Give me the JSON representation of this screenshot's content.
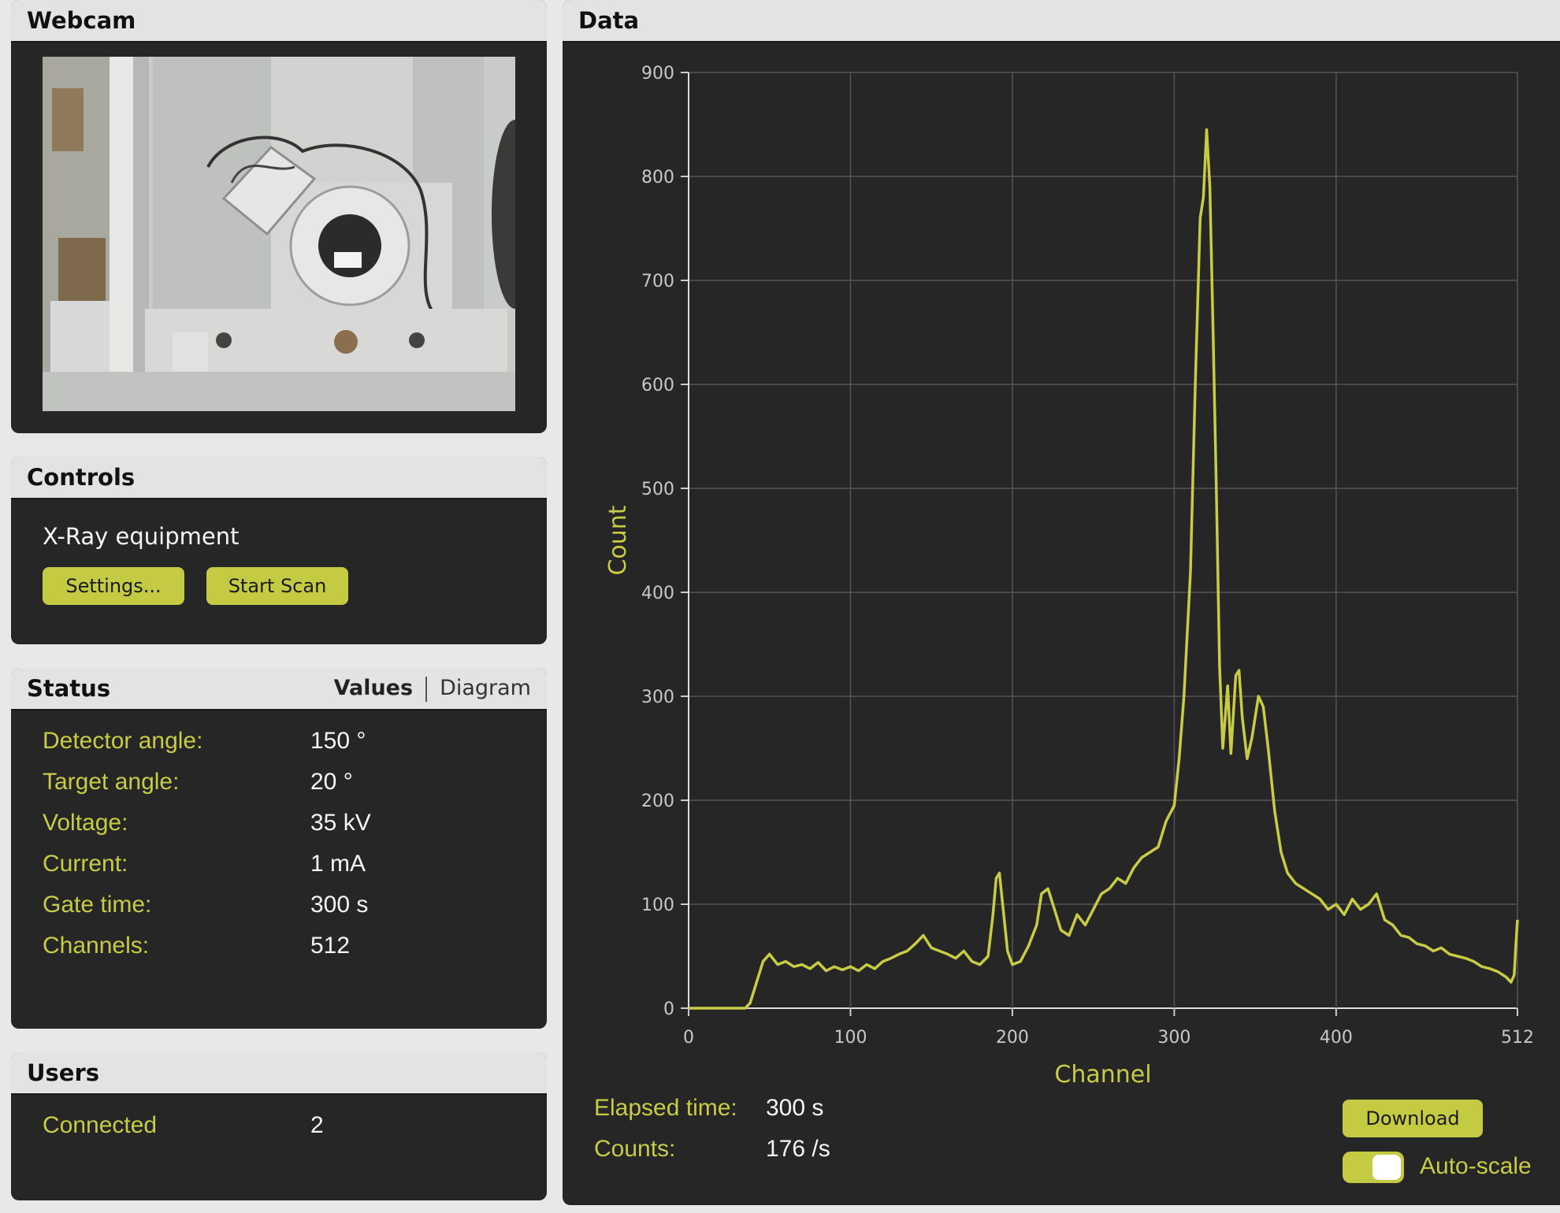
{
  "webcam": {
    "title": "Webcam"
  },
  "controls": {
    "title": "Controls",
    "equipment_label": "X-Ray equipment",
    "settings_label": "Settings...",
    "start_label": "Start Scan"
  },
  "status": {
    "title": "Status",
    "tab_values": "Values",
    "tab_diagram": "Diagram",
    "rows": [
      {
        "label": "Detector angle:",
        "value": "150 °"
      },
      {
        "label": "Target angle:",
        "value": "20 °"
      },
      {
        "label": "Voltage:",
        "value": "35 kV"
      },
      {
        "label": "Current:",
        "value": "1 mA"
      },
      {
        "label": "Gate time:",
        "value": "300 s"
      },
      {
        "label": "Channels:",
        "value": "512"
      }
    ]
  },
  "users": {
    "title": "Users",
    "connected_label": "Connected",
    "connected_value": "2"
  },
  "data_panel": {
    "title": "Data",
    "elapsed_label": "Elapsed time:",
    "elapsed_value": "300 s",
    "counts_label": "Counts:",
    "counts_value": "176 /s",
    "download_label": "Download",
    "autoscale_label": "Auto-scale",
    "autoscale_on": true
  },
  "colors": {
    "accent": "#c8cc45",
    "panel_bg": "#262626",
    "header_bg": "#e3e3e3"
  },
  "chart_data": {
    "type": "line",
    "xlabel": "Channel",
    "ylabel": "Count",
    "xlim": [
      0,
      512
    ],
    "ylim": [
      0,
      900
    ],
    "x_ticks": [
      "0",
      "100",
      "200",
      "300",
      "400",
      "512"
    ],
    "y_ticks": [
      "0",
      "100",
      "200",
      "300",
      "400",
      "500",
      "600",
      "700",
      "800",
      "900"
    ],
    "grid": true,
    "series": [
      {
        "color": "#c8cc45",
        "points": [
          [
            0,
            0
          ],
          [
            20,
            0
          ],
          [
            35,
            0
          ],
          [
            38,
            5
          ],
          [
            42,
            25
          ],
          [
            46,
            45
          ],
          [
            50,
            52
          ],
          [
            55,
            42
          ],
          [
            60,
            45
          ],
          [
            65,
            40
          ],
          [
            70,
            42
          ],
          [
            75,
            38
          ],
          [
            80,
            44
          ],
          [
            85,
            36
          ],
          [
            90,
            40
          ],
          [
            95,
            37
          ],
          [
            100,
            40
          ],
          [
            105,
            36
          ],
          [
            110,
            42
          ],
          [
            115,
            38
          ],
          [
            120,
            45
          ],
          [
            125,
            48
          ],
          [
            130,
            52
          ],
          [
            135,
            55
          ],
          [
            140,
            62
          ],
          [
            145,
            70
          ],
          [
            150,
            58
          ],
          [
            155,
            55
          ],
          [
            160,
            52
          ],
          [
            165,
            48
          ],
          [
            170,
            55
          ],
          [
            175,
            45
          ],
          [
            180,
            42
          ],
          [
            185,
            50
          ],
          [
            188,
            90
          ],
          [
            190,
            125
          ],
          [
            192,
            130
          ],
          [
            194,
            100
          ],
          [
            197,
            55
          ],
          [
            200,
            42
          ],
          [
            205,
            45
          ],
          [
            210,
            60
          ],
          [
            215,
            80
          ],
          [
            218,
            110
          ],
          [
            222,
            115
          ],
          [
            226,
            95
          ],
          [
            230,
            75
          ],
          [
            235,
            70
          ],
          [
            240,
            90
          ],
          [
            245,
            80
          ],
          [
            250,
            95
          ],
          [
            255,
            110
          ],
          [
            260,
            115
          ],
          [
            265,
            125
          ],
          [
            270,
            120
          ],
          [
            275,
            135
          ],
          [
            280,
            145
          ],
          [
            285,
            150
          ],
          [
            290,
            155
          ],
          [
            295,
            180
          ],
          [
            300,
            195
          ],
          [
            303,
            240
          ],
          [
            306,
            300
          ],
          [
            310,
            420
          ],
          [
            313,
            600
          ],
          [
            316,
            760
          ],
          [
            318,
            780
          ],
          [
            320,
            845
          ],
          [
            322,
            790
          ],
          [
            324,
            650
          ],
          [
            326,
            500
          ],
          [
            328,
            330
          ],
          [
            330,
            250
          ],
          [
            333,
            310
          ],
          [
            335,
            245
          ],
          [
            338,
            320
          ],
          [
            340,
            325
          ],
          [
            342,
            280
          ],
          [
            345,
            240
          ],
          [
            348,
            260
          ],
          [
            352,
            300
          ],
          [
            355,
            290
          ],
          [
            358,
            250
          ],
          [
            362,
            190
          ],
          [
            366,
            150
          ],
          [
            370,
            130
          ],
          [
            375,
            120
          ],
          [
            380,
            115
          ],
          [
            385,
            110
          ],
          [
            390,
            105
          ],
          [
            395,
            95
          ],
          [
            400,
            100
          ],
          [
            405,
            90
          ],
          [
            410,
            105
          ],
          [
            415,
            95
          ],
          [
            420,
            100
          ],
          [
            425,
            110
          ],
          [
            430,
            85
          ],
          [
            435,
            80
          ],
          [
            440,
            70
          ],
          [
            445,
            68
          ],
          [
            450,
            62
          ],
          [
            455,
            60
          ],
          [
            460,
            55
          ],
          [
            465,
            58
          ],
          [
            470,
            52
          ],
          [
            475,
            50
          ],
          [
            480,
            48
          ],
          [
            485,
            45
          ],
          [
            490,
            40
          ],
          [
            495,
            38
          ],
          [
            500,
            35
          ],
          [
            505,
            30
          ],
          [
            508,
            25
          ],
          [
            510,
            32
          ],
          [
            511,
            60
          ],
          [
            512,
            85
          ]
        ]
      }
    ]
  }
}
